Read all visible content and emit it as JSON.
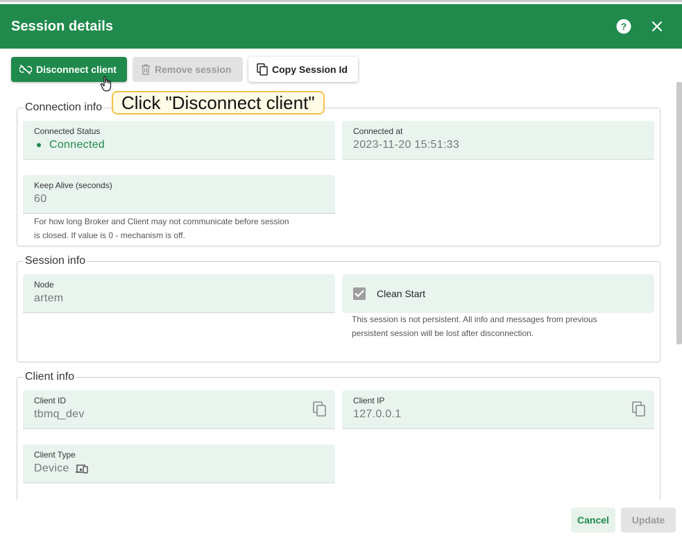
{
  "header": {
    "title": "Session details"
  },
  "toolbar": {
    "disconnect_label": "Disconnect client",
    "remove_label": "Remove session",
    "copy_label": "Copy Session Id"
  },
  "callout": {
    "text": "Click \"Disconnect client\""
  },
  "connection_info": {
    "legend": "Connection info",
    "connected_status_label": "Connected Status",
    "connected_status_value": "Connected",
    "connected_at_label": "Connected at",
    "connected_at_value": "2023-11-20 15:51:33",
    "keep_alive_label": "Keep Alive (seconds)",
    "keep_alive_value": "60",
    "keep_alive_hint_line1": "For how long Broker and Client may not communicate before session",
    "keep_alive_hint_line2": "is closed. If value is 0 - mechanism is off."
  },
  "session_info": {
    "legend": "Session info",
    "node_label": "Node",
    "node_value": "artem",
    "clean_start_label": "Clean Start",
    "clean_start_checked": true,
    "clean_start_hint_line1": "This session is not persistent. All info and messages from previous",
    "clean_start_hint_line2": "persistent session will be lost after disconnection."
  },
  "client_info": {
    "legend": "Client info",
    "client_id_label": "Client ID",
    "client_id_value": "tbmq_dev",
    "client_ip_label": "Client IP",
    "client_ip_value": "127.0.0.1",
    "client_type_label": "Client Type",
    "client_type_value": "Device"
  },
  "footer": {
    "cancel_label": "Cancel",
    "update_label": "Update"
  },
  "colors": {
    "brand_green": "#1f8a4c",
    "field_bg": "#eaf4ee",
    "callout_border": "#f1c24a"
  },
  "icons": {
    "help": "help-circle-icon",
    "close": "close-icon",
    "disconnect": "link-off-icon",
    "remove": "trash-icon",
    "copy": "copy-icon",
    "device": "devices-icon",
    "check": "check-icon"
  }
}
